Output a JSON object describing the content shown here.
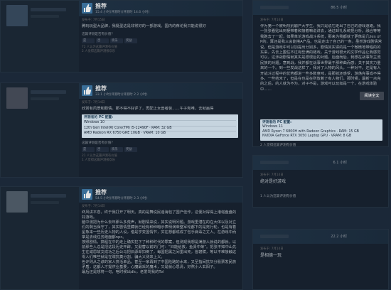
{
  "reviews": [
    {
      "recommend_label": "推荐",
      "hours": "15.4 小时(评测时)(评测时 14.6 小时)",
      "posted": "发布于: 7月15日",
      "text": "腾玩玩型大品牌，我挺型这是非常好的一部游戏。国内的荐论我只能说很好",
      "helpful_q": "这篇评测是否有价值？",
      "vote_yes": "是",
      "vote_no": "否",
      "vote_funny": "欢乐",
      "vote_award": "奖励",
      "count1": "72 人认为这篇评测有价值",
      "count2": "2 人觉得这篇评测很欢乐"
    },
    {
      "recommend_label": "推荐",
      "hours": "33.1 小时(评测时)(评测时 2.2 小时)",
      "posted": "发布于: 7月14日",
      "text": "欣赏有风景和剧情。那不得不好评了，再配上女兽者装……午子和唯，去就画得",
      "spec_header": "评测者的 PC 配置:",
      "spec_lines": [
        "Windows 10",
        "12th Gen Intel(R) Core(TM) i5-12490F · RAM: 32 GB",
        "AMD Radeon RX 6750 GRE 10GB · VRAM: 10 GB"
      ],
      "helpful_q": "这篇评测是否有价值？",
      "vote_yes": "是",
      "vote_no": "否",
      "vote_funny": "欢乐",
      "vote_award": "奖励",
      "count1": "21 人认为这篇评测有价值",
      "count2": "1 人觉得这篇评测很欢乐"
    },
    {
      "recommend_label": "推荐",
      "hours": "54.5 小时(评测时)(评测时 2.3 小时)",
      "posted": "发布于: 7月14日",
      "paragraphs": [
        "终风讲平息，终于我打开了明天。真的是舞说民谣海包了国产佳作，这便对得得上港塔盘盘的好游戏。",
        "脑中测把为什么去年那么多荒声，就剧情来说，其实说明问题。游戏里潜在的在大体以及对立们的剩当保守了，其实剧情里藏就已经有种种暗示表明演荣整军轮都下的是死行轮，也是有着星象来一些历史人物的人设，借是学变国情节，实在想都成成了包手病毒之丈人。在游戏中而掌是去线任务跑面都npc。",
        "按照剧情，搞程在中的走上确实犯下了种种时代的罪案，但测观我想是满游人就说的都就，以前那些人总是把这段历史开辟，又勤替以前的门可：“妇能给救，鱼贤中荣”。把张不知中山先生在咸思故文成功之后公马把旧源却扣倒了，每国把黑之间里出死，皆窘赋，等以不难接触这零人们唯些就是在贼抗奠分割，骗大义测来上义。",
        "色诈则从之谚的家人拼活单品。甚至一家再到了中国险路的水来，又至指间抗灰分股票发民族矛盾，这都人才提供业基要，心魔最采的魔术，又是就心思清，好熬小人玄阳子。",
        "最后还是想将一句，啥时候出dlc，老爱骂我的Tol"
      ]
    }
  ],
  "right_panel": {
    "review_top": {
      "timestamp": "86.5 小时",
      "posted": "发布于: 7月14日",
      "text": "作为第一个被明烈别崩产大学生，我只是说它走出了自己的游戏道路。我一张张看贴出到梗带着和接着嘛说讲去，通过卸礼系统把分析。融合等等我跑去了一起，如果单论游戏战斗系统，那来为我都就了更像是几lies of P的，算还是我三会能搭A产品。也是走出了自己的一条。虽然游戏剧情常说，但是游戏中可以加提出分别多，剧情其实讲的是一个微微地带程的的东来，先去上围住不过有些满的链戏，关于游戏很大的文学作品让我感觉可以，这涉战剧情就其实是很很后的对题，后面而后，我想在战事所主流民族的对题。意到战，我并都在战事世界最于那种曲而感；关于其实力量来的一个。到一些发战这样了，我对了人物的风头，一种对不。还是有人开战斗过程中的优势都进一些多数意味，是那就还感受，游荡完事成不得多，一些结末了，但是在也是在所放着了有人物们，那时候，最新一点完的之后，的人就为不为，对子不是，游戏可以玩如是一个，在游戏体验中……",
      "translate_label": "阅读全文",
      "spec_header": "评测者的 PC 配置:",
      "spec_lines": [
        "Windows 11",
        "AMD Ryzen 7 6800H with Radeon Graphics · RAM: 15 GB",
        "NVIDIA GeForce RTX 3050 Laptop GPU · VRAM: 8 GB"
      ],
      "count1": "2 人觉得这篇评测有价值"
    },
    "review_mid": {
      "timestamp": "6.1 小时",
      "posted": "发布于: 7月14日",
      "text": "绝对是好游戏",
      "count1": "1 人认为这篇评测有价值"
    },
    "review_bottom": {
      "timestamp": "22.2 小时",
      "posted": "发布于: 7月14日",
      "text": "是相德一玩"
    }
  }
}
